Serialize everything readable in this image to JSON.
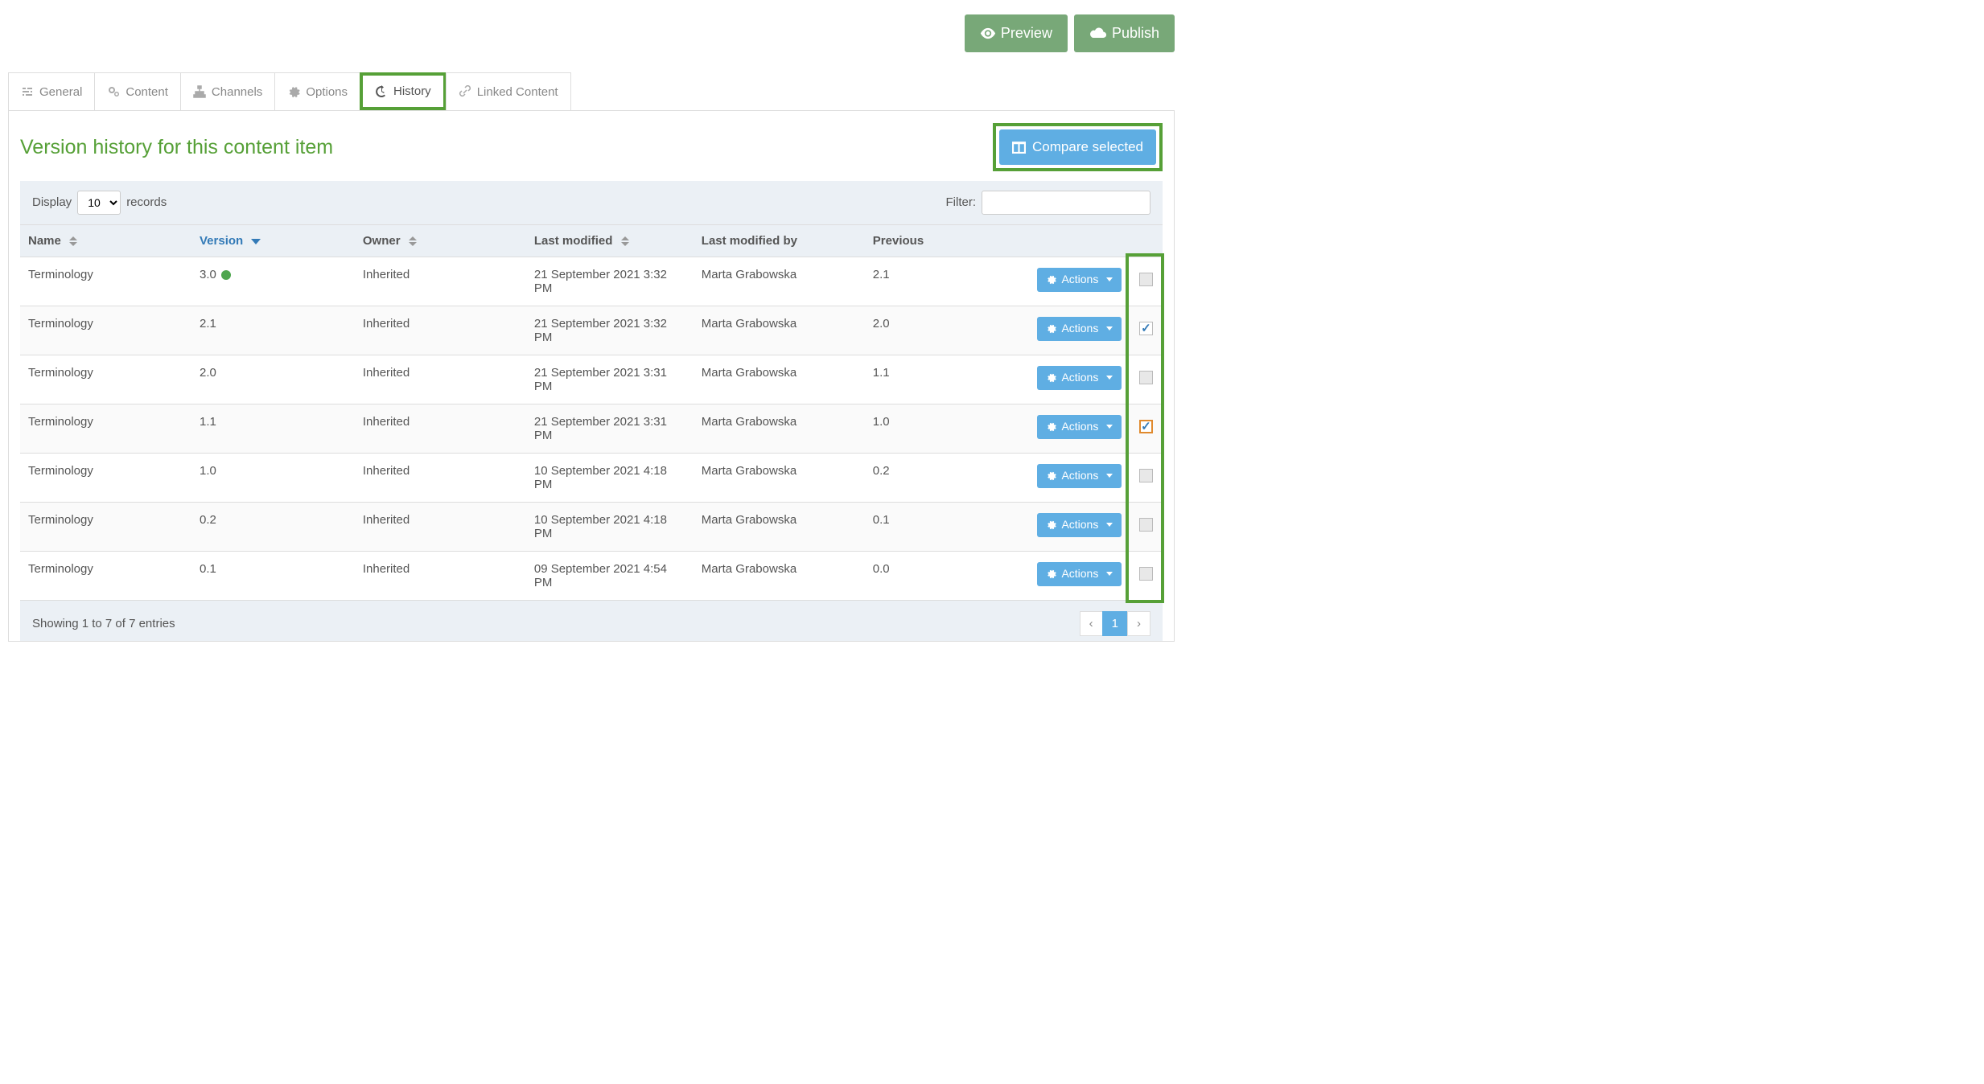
{
  "top": {
    "preview": "Preview",
    "publish": "Publish"
  },
  "tabs": {
    "general": "General",
    "content": "Content",
    "channels": "Channels",
    "options": "Options",
    "history": "History",
    "linked": "Linked Content"
  },
  "panel": {
    "title": "Version history for this content item",
    "compare": "Compare selected"
  },
  "controls": {
    "display_label": "Display",
    "display_value": "10",
    "records_label": "records",
    "filter_label": "Filter:",
    "filter_value": ""
  },
  "headers": {
    "name": "Name",
    "version": "Version",
    "owner": "Owner",
    "last_modified": "Last modified",
    "last_modified_by": "Last modified by",
    "previous": "Previous"
  },
  "rows": [
    {
      "name": "Terminology",
      "version": "3.0",
      "current": true,
      "owner": "Inherited",
      "last_modified": "21 September 2021 3:32 PM",
      "last_modified_by": "Marta Grabowska",
      "previous": "2.1",
      "checked": false,
      "check_style": ""
    },
    {
      "name": "Terminology",
      "version": "2.1",
      "current": false,
      "owner": "Inherited",
      "last_modified": "21 September 2021 3:32 PM",
      "last_modified_by": "Marta Grabowska",
      "previous": "2.0",
      "checked": true,
      "check_style": "blue"
    },
    {
      "name": "Terminology",
      "version": "2.0",
      "current": false,
      "owner": "Inherited",
      "last_modified": "21 September 2021 3:31 PM",
      "last_modified_by": "Marta Grabowska",
      "previous": "1.1",
      "checked": false,
      "check_style": ""
    },
    {
      "name": "Terminology",
      "version": "1.1",
      "current": false,
      "owner": "Inherited",
      "last_modified": "21 September 2021 3:31 PM",
      "last_modified_by": "Marta Grabowska",
      "previous": "1.0",
      "checked": true,
      "check_style": "orange"
    },
    {
      "name": "Terminology",
      "version": "1.0",
      "current": false,
      "owner": "Inherited",
      "last_modified": "10 September 2021 4:18 PM",
      "last_modified_by": "Marta Grabowska",
      "previous": "0.2",
      "checked": false,
      "check_style": ""
    },
    {
      "name": "Terminology",
      "version": "0.2",
      "current": false,
      "owner": "Inherited",
      "last_modified": "10 September 2021 4:18 PM",
      "last_modified_by": "Marta Grabowska",
      "previous": "0.1",
      "checked": false,
      "check_style": ""
    },
    {
      "name": "Terminology",
      "version": "0.1",
      "current": false,
      "owner": "Inherited",
      "last_modified": "09 September 2021 4:54 PM",
      "last_modified_by": "Marta Grabowska",
      "previous": "0.0",
      "checked": false,
      "check_style": ""
    }
  ],
  "actions_label": "Actions",
  "footer": {
    "summary": "Showing 1 to 7 of 7 entries",
    "page": "1"
  }
}
